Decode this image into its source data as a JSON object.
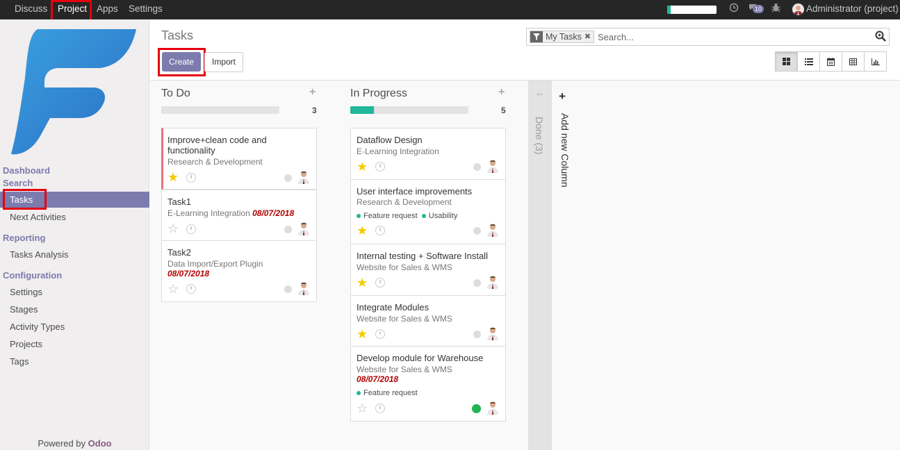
{
  "topbar": {
    "menus": [
      "Discuss",
      "Project",
      "Apps",
      "Settings"
    ],
    "active_menu": "Project",
    "messages_count": "10",
    "user": "Administrator (project)",
    "onboarding_progress": 0.07
  },
  "sidebar": {
    "sections": {
      "dashboard": "Dashboard",
      "search": "Search",
      "reporting": "Reporting",
      "configuration": "Configuration"
    },
    "search_items": [
      "Tasks",
      "Next Activities"
    ],
    "reporting_items": [
      "Tasks Analysis"
    ],
    "configuration_items": [
      "Settings",
      "Stages",
      "Activity Types",
      "Projects",
      "Tags"
    ],
    "active_item": "Tasks",
    "powered_by": "Powered by",
    "powered_brand": "Odoo"
  },
  "control_panel": {
    "title": "Tasks",
    "create_label": "Create",
    "import_label": "Import",
    "facet": "My Tasks",
    "search_placeholder": "Search...",
    "views": [
      "kanban-icon",
      "list-icon",
      "calendar-icon",
      "pivot-icon",
      "graph-icon"
    ],
    "active_view": "kanban-icon"
  },
  "kanban": {
    "columns": [
      {
        "title": "To Do",
        "count": "3",
        "progress_ok": 0,
        "cards": [
          {
            "title": "Improve+clean code and functionality",
            "project": "Research & Development",
            "date": "",
            "starred": true,
            "tags": [],
            "state": "normal",
            "priority_border": true
          },
          {
            "title": "Task1",
            "project": "E-Learning Integration",
            "date": "08/07/2018",
            "starred": false,
            "tags": [],
            "state": "normal",
            "priority_border": false
          },
          {
            "title": "Task2",
            "project": "Data Import/Export Plugin",
            "date": "08/07/2018",
            "starred": false,
            "tags": [],
            "state": "normal",
            "priority_border": false
          }
        ]
      },
      {
        "title": "In Progress",
        "count": "5",
        "progress_ok": 0.2,
        "cards": [
          {
            "title": "Dataflow Design",
            "project": "E-Learning Integration",
            "date": "",
            "starred": true,
            "tags": [],
            "state": "normal"
          },
          {
            "title": "User interface improvements",
            "project": "Research & Development",
            "date": "",
            "starred": true,
            "tags": [
              "Feature request",
              "Usability"
            ],
            "state": "normal"
          },
          {
            "title": "Internal testing + Software Install",
            "project": "Website for Sales & WMS",
            "date": "",
            "starred": true,
            "tags": [],
            "state": "normal"
          },
          {
            "title": "Integrate Modules",
            "project": "Website for Sales & WMS",
            "date": "",
            "starred": true,
            "tags": [],
            "state": "normal"
          },
          {
            "title": "Develop module for Warehouse",
            "project": "Website for Sales & WMS",
            "date": "08/07/2018",
            "starred": false,
            "tags": [
              "Feature request"
            ],
            "state": "done"
          }
        ]
      }
    ],
    "folded_column": "Done (3)",
    "add_column_label": "Add new Column"
  },
  "colors": {
    "brand": "#7c7bad",
    "highlight": "#e6000f",
    "topbar": "#262626",
    "deadline": "#b20000",
    "star": "#f3cc00",
    "tag": "#21b799"
  }
}
